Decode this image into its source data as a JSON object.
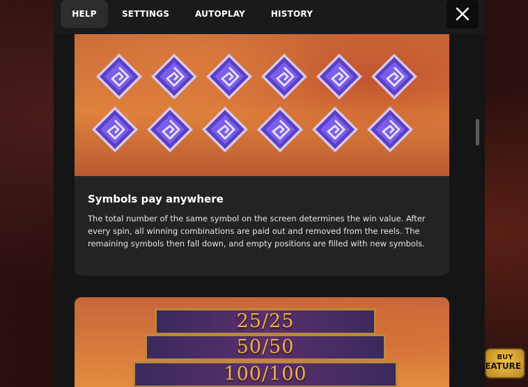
{
  "tabs": [
    {
      "label": "HELP",
      "active": true
    },
    {
      "label": "SETTINGS",
      "active": false
    },
    {
      "label": "AUTOPLAY",
      "active": false
    },
    {
      "label": "HISTORY",
      "active": false
    }
  ],
  "close_icon": "close-icon",
  "info_card": {
    "image_icon": "gem-symbol-icon",
    "gem_count": 12,
    "title": "Symbols pay anywhere",
    "body": "The total number of the same symbol on the screen determines the win value. After every spin, all winning combinations are paid out and removed from the reels. The remaining symbols then fall down, and empty positions are filled with new symbols."
  },
  "tiers_card": {
    "tiers": [
      "25/25",
      "50/50",
      "100/100"
    ]
  },
  "buy_feature": {
    "line1": "BUY",
    "line2": "FEATURE"
  },
  "colors": {
    "panel": "#151515",
    "card": "#232323",
    "active_tab": "#2d2d2d",
    "gold": "#e8b24a",
    "gem": "#5b3fc4"
  }
}
